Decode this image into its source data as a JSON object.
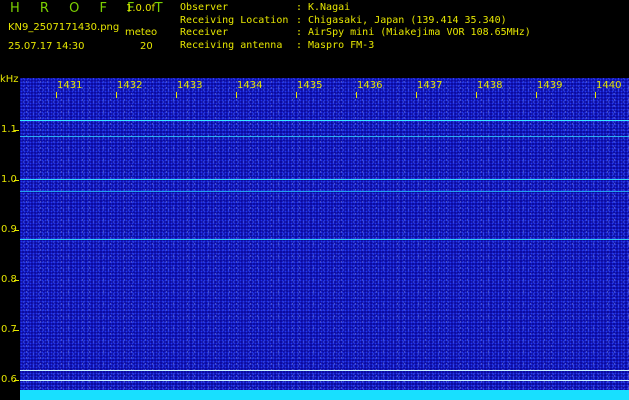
{
  "header": {
    "app_title": "H R O F F T",
    "version": "1.0.0f",
    "filename": "KN9_2507171430.png",
    "meteo_label": "meteo",
    "datetime": "25.07.17 14:30",
    "count": "20",
    "info": [
      {
        "label": "Observer",
        "value": "K.Nagai"
      },
      {
        "label": "Receiving Location",
        "value": "Chigasaki, Japan (139.414 35.340)"
      },
      {
        "label": "Receiver",
        "value": "AirSpy mini (Miakejima VOR 108.65MHz)"
      },
      {
        "label": "Receiving antenna",
        "value": "Maspro FM-3"
      }
    ]
  },
  "spectrogram": {
    "y_unit": "kHz",
    "y_labels": [
      "1.1",
      "1.0",
      "0.9",
      "0.8",
      "0.7",
      "0.6"
    ],
    "x_labels": [
      "1431",
      "1432",
      "1433",
      "1434",
      "1435",
      "1436",
      "1437",
      "1438",
      "1439",
      "1440"
    ],
    "colors": {
      "background": "#0b0ba0",
      "signal": "#18e0ff",
      "text": "#e6e600"
    }
  }
}
